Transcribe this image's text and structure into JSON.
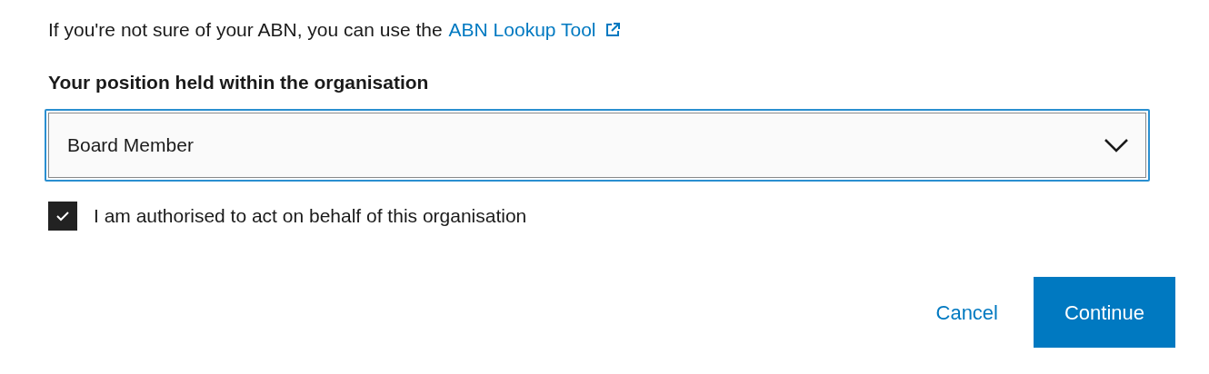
{
  "intro": {
    "text": "If you're not sure of your ABN, you can use the",
    "link": "ABN Lookup Tool"
  },
  "position_field": {
    "label": "Your position held within the organisation",
    "value": "Board Member",
    "focused": true
  },
  "authorised_checkbox": {
    "label": "I am authorised to act on behalf of this organisation",
    "checked": true
  },
  "buttons": [
    {
      "label": "Cancel",
      "kind": "link"
    },
    {
      "label": "Continue",
      "kind": "primary"
    }
  ]
}
